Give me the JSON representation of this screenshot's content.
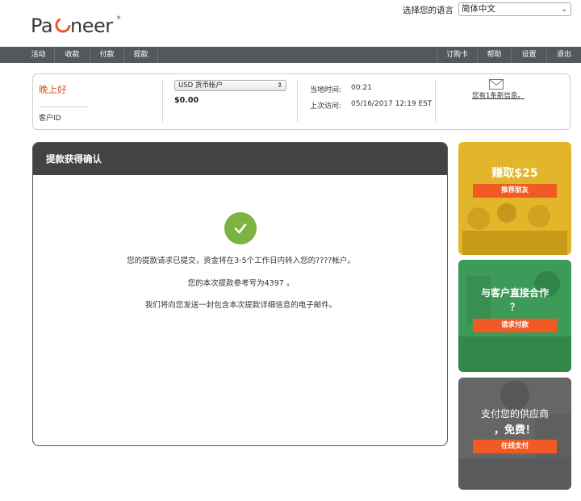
{
  "brand": {
    "name": "Payoneer",
    "accent": "#e04e1b"
  },
  "language": {
    "label": "选择您的语言",
    "selected": "简体中文"
  },
  "nav": {
    "left": [
      "活动",
      "收款",
      "付款",
      "提款"
    ],
    "right": [
      "订购卡",
      "帮助",
      "设置",
      "退出"
    ]
  },
  "account": {
    "greeting": "晚上好",
    "customer_id_label": "客户ID",
    "currency_account": "USD 货币帐户",
    "balance": "$0.00",
    "local_time_label": "当地时间:",
    "local_time": "00:21",
    "last_visit_label": "上次访问:",
    "last_visit": "05/16/2017 12:19 EST",
    "messages_link": "您有1条新信息。"
  },
  "confirmation": {
    "title": "提款获得确认",
    "line1": "您的提款请求已提交，资金将在3-5个工作日内转入您的????帐户。",
    "line2": "您的本次提款参考号为4397      。",
    "line3": "我们将向您发送一封包含本次提款详细信息的电子邮件。"
  },
  "promos": [
    {
      "title": "赚取$25",
      "button": "推荐朋友",
      "color": "#e3b52a"
    },
    {
      "title_line1": "与客户直接合作",
      "title_line2": "？",
      "button": "请求付款",
      "color": "#3e9a58"
    },
    {
      "title_line1": "支付您的供应商",
      "title_line2": "，免费！",
      "button": "在线支付",
      "color": "#666666"
    }
  ]
}
